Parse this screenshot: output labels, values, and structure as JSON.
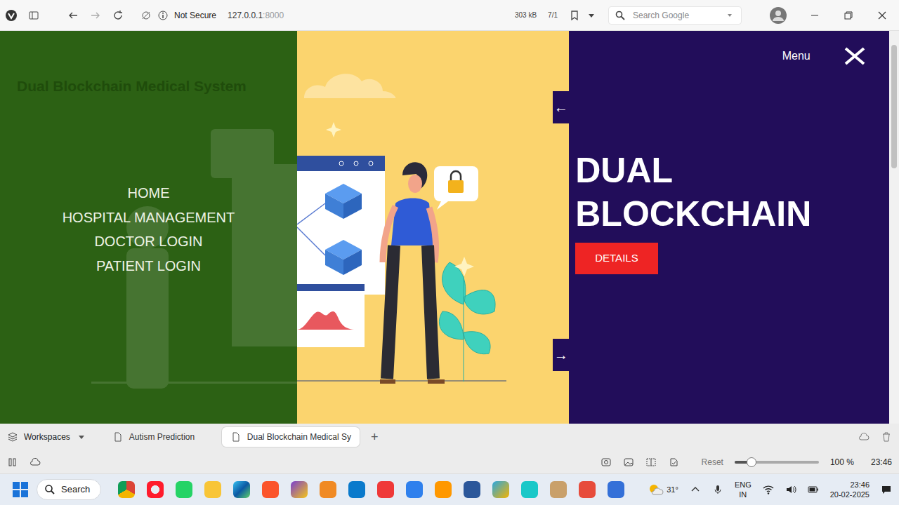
{
  "browser": {
    "security": "Not Secure",
    "host": "127.0.0.1",
    "port": ":8000",
    "page_size": "303 kB",
    "counter": "7/1",
    "search": {
      "placeholder": "Search Google"
    }
  },
  "page": {
    "site_title": "Dual Blockchain Medical System",
    "nav": [
      {
        "label": "HOME"
      },
      {
        "label": "HOSPITAL MANAGEMENT"
      },
      {
        "label": "DOCTOR LOGIN"
      },
      {
        "label": "PATIENT LOGIN"
      }
    ],
    "menu_label": "Menu",
    "prev": "←",
    "next": "→",
    "hero_title": "DUAL BLOCKCHAIN",
    "details_button": "DETAILS"
  },
  "bottom_bar": {
    "workspaces": "Workspaces",
    "tabs": [
      {
        "label": "Autism Prediction",
        "selected": false
      },
      {
        "label": "Dual Blockchain Medical Sy",
        "selected": true
      }
    ],
    "new_tab": "+",
    "reset": "Reset",
    "zoom": {
      "level": 0.2,
      "reading": "100 %"
    },
    "clock": "23:46"
  },
  "taskbar": {
    "search": "Search",
    "weather": "31°",
    "language": "ENG",
    "region": "IN",
    "time": "23:46",
    "date": "20-02-2025"
  }
}
